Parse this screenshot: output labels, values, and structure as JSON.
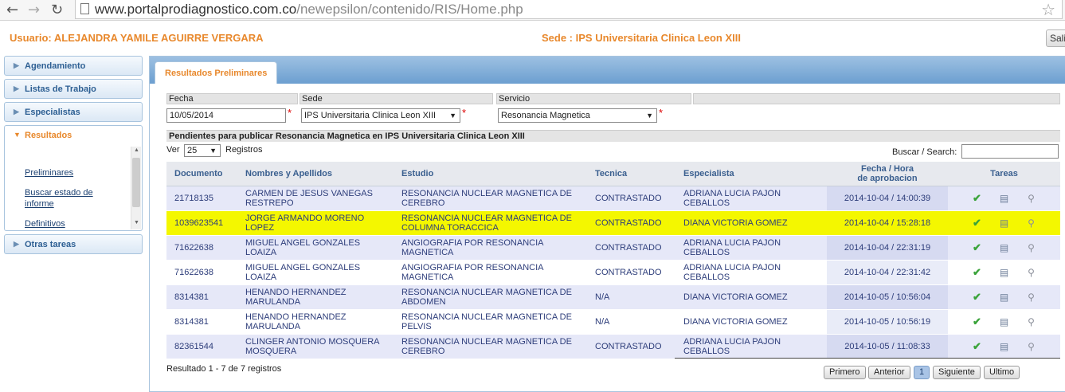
{
  "browser": {
    "url_host": "www.portalprodiagnostico.com.co",
    "url_path": "/newepsilon/contenido/RIS/Home.php"
  },
  "header": {
    "usuario": "Usuario: ALEJANDRA YAMILE AGUIRRE VERGARA",
    "sede": "Sede : IPS Universitaria Clinica Leon XIII",
    "salir": "Sali"
  },
  "sidebar": {
    "items": [
      {
        "label": "Agendamiento"
      },
      {
        "label": "Listas de Trabajo"
      },
      {
        "label": "Especialistas"
      },
      {
        "label": "Resultados"
      },
      {
        "label": "Otras tareas"
      }
    ],
    "sub": {
      "preliminares": "Preliminares",
      "buscar_l1": "Buscar estado de",
      "buscar_l2": "informe",
      "definitivos": "Definitivos"
    }
  },
  "tab": {
    "label": "Resultados Preliminares"
  },
  "filters": {
    "fecha_label": "Fecha",
    "fecha_value": "10/05/2014",
    "sede_label": "Sede",
    "sede_value": "IPS Universitaria Clinica Leon XIII",
    "servicio_label": "Servicio",
    "servicio_value": "Resonancia Magnetica",
    "required_mark": "*"
  },
  "pending_title": "Pendientes para publicar Resonancia Magnetica en IPS Universitaria Clinica Leon XIII",
  "list_controls": {
    "ver": "Ver",
    "page_size": "25",
    "registros": "Registros",
    "buscar": "Buscar / Search:"
  },
  "table": {
    "headers": {
      "documento": "Documento",
      "nombres": "Nombres y Apellidos",
      "estudio": "Estudio",
      "tecnica": "Tecnica",
      "especialista": "Especialista",
      "fecha_l1": "Fecha / Hora",
      "fecha_l2": "de aprobacion",
      "tareas": "Tareas"
    },
    "rows": [
      {
        "doc": "21718135",
        "nombre1": "CARMEN DE JESUS VANEGAS",
        "nombre2": "RESTREPO",
        "estudio1": "RESONANCIA NUCLEAR MAGNETICA DE",
        "estudio2": "CEREBRO",
        "tecnica": "CONTRASTADO",
        "esp1": "ADRIANA LUCIA PAJON",
        "esp2": "CEBALLOS",
        "fecha": "2014-10-04 / 14:00:39",
        "highlighted": false
      },
      {
        "doc": "1039623541",
        "nombre1": "JORGE ARMANDO MORENO",
        "nombre2": "LOPEZ",
        "estudio1": "RESONANCIA NUCLEAR MAGNETICA DE",
        "estudio2": "COLUMNA TORACCICA",
        "tecnica": "CONTRASTADO",
        "esp1": "DIANA VICTORIA GOMEZ",
        "esp2": "",
        "fecha": "2014-10-04 / 15:28:18",
        "highlighted": true
      },
      {
        "doc": "71622638",
        "nombre1": "MIGUEL ANGEL GONZALES",
        "nombre2": "LOAIZA",
        "estudio1": "ANGIOGRAFIA POR RESONANCIA",
        "estudio2": "MAGNETICA",
        "tecnica": "CONTRASTADO",
        "esp1": "ADRIANA LUCIA PAJON",
        "esp2": "CEBALLOS",
        "fecha": "2014-10-04 / 22:31:19",
        "highlighted": false
      },
      {
        "doc": "71622638",
        "nombre1": "MIGUEL ANGEL GONZALES",
        "nombre2": "LOAIZA",
        "estudio1": "ANGIOGRAFIA POR RESONANCIA",
        "estudio2": "MAGNETICA",
        "tecnica": "CONTRASTADO",
        "esp1": "ADRIANA LUCIA PAJON",
        "esp2": "CEBALLOS",
        "fecha": "2014-10-04 / 22:31:42",
        "highlighted": false
      },
      {
        "doc": "8314381",
        "nombre1": "HENANDO HERNANDEZ",
        "nombre2": "MARULANDA",
        "estudio1": "RESONANCIA NUCLEAR MAGNETICA DE",
        "estudio2": "ABDOMEN",
        "tecnica": "N/A",
        "esp1": "DIANA VICTORIA GOMEZ",
        "esp2": "",
        "fecha": "2014-10-05 / 10:56:04",
        "highlighted": false
      },
      {
        "doc": "8314381",
        "nombre1": "HENANDO HERNANDEZ",
        "nombre2": "MARULANDA",
        "estudio1": "RESONANCIA NUCLEAR MAGNETICA DE",
        "estudio2": "PELVIS",
        "tecnica": "N/A",
        "esp1": "DIANA VICTORIA GOMEZ",
        "esp2": "",
        "fecha": "2014-10-05 / 10:56:19",
        "highlighted": false
      },
      {
        "doc": "82361544",
        "nombre1": "CLINGER ANTONIO MOSQUERA",
        "nombre2": "MOSQUERA",
        "estudio1": "RESONANCIA NUCLEAR MAGNETICA DE",
        "estudio2": "CEREBRO",
        "tecnica": "CONTRASTADO",
        "esp1": "ADRIANA LUCIA PAJON",
        "esp2": "CEBALLOS",
        "fecha": "2014-10-05 / 11:08:33",
        "highlighted": false
      }
    ]
  },
  "footer": {
    "resultado": "Resultado 1 - 7 de 7 registros",
    "primero": "Primero",
    "anterior": "Anterior",
    "page": "1",
    "siguiente": "Siguiente",
    "ultimo": "Ultimo"
  },
  "colors": {
    "accent_orange": "#e8882c",
    "link_blue": "#2d5f93",
    "highlight_yellow": "#f4f700",
    "check_green": "#3aa33a"
  },
  "icons": [
    "back-arrow-icon",
    "forward-arrow-icon",
    "reload-icon",
    "page-icon",
    "star-icon",
    "triangle-right-icon",
    "triangle-down-icon",
    "check-icon",
    "print-icon",
    "magnifier-icon"
  ]
}
